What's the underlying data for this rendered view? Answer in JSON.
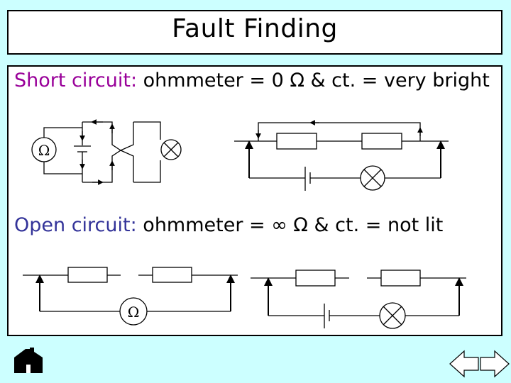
{
  "header": {
    "title": "Fault Finding"
  },
  "short_circuit": {
    "label": "Short circuit:",
    "description": "ohmmeter = 0 Ω & ct. = very bright",
    "meter_symbol": "Ω"
  },
  "open_circuit": {
    "label": "Open circuit:",
    "description": "ohmmeter = ∞ Ω & ct. = not lit",
    "meter_symbol": "Ω"
  },
  "colors": {
    "background": "#ccffff",
    "short_label": "#990099",
    "open_label": "#333399"
  },
  "nav": {
    "home": "home-icon",
    "back": "back-arrow-icon",
    "forward": "forward-arrow-icon"
  }
}
